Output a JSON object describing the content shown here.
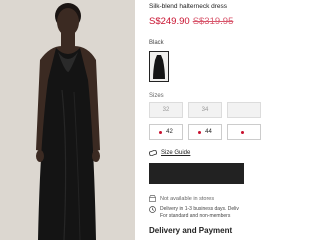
{
  "product": {
    "name": "Silk-blend halterneck dress",
    "price_current": "S$249.90",
    "price_original": "S$319.95"
  },
  "color": {
    "label": "Black",
    "selected": "black"
  },
  "sizes": {
    "label": "Sizes",
    "items": [
      {
        "label": "32",
        "available": false
      },
      {
        "label": "34",
        "available": false
      },
      {
        "label": "",
        "available": false
      },
      {
        "label": "42",
        "available": true
      },
      {
        "label": "44",
        "available": true
      },
      {
        "label": "",
        "available": true
      }
    ]
  },
  "size_guide": {
    "label": "Size Guide"
  },
  "stores": {
    "label": "Not available in stores"
  },
  "delivery": {
    "line1": "Delivery in 1-3 business days. Deliv",
    "line2": "For standard and non-members"
  },
  "sections": {
    "delivery_returns": "Delivery and Payment"
  },
  "colors": {
    "accent": "#c8102e",
    "button": "#222222"
  }
}
